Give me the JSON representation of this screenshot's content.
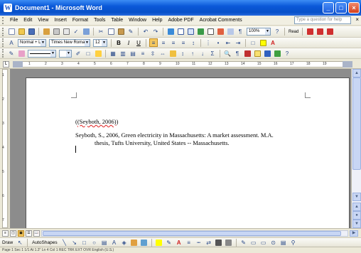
{
  "window": {
    "title": "Document1 - Microsoft Word",
    "app_icon_glyph": "W"
  },
  "menubar": {
    "items": [
      "File",
      "Edit",
      "View",
      "Insert",
      "Format",
      "Tools",
      "Table",
      "Window",
      "Help",
      "Adobe PDF",
      "Acrobat Comments"
    ],
    "help_placeholder": "Type a question for help"
  },
  "formatting": {
    "style": "Normal + Left:",
    "font": "Times New Roman",
    "size": "12",
    "bold": "B",
    "italic": "I",
    "underline": "U"
  },
  "standard": {
    "zoom": "100%",
    "read_label": "Read"
  },
  "ruler": {
    "ticks": [
      "1",
      "2",
      "3",
      "4",
      "5",
      "6",
      "7",
      "8",
      "9",
      "10",
      "11",
      "12",
      "13",
      "14",
      "15",
      "16",
      "17",
      "18",
      "19"
    ]
  },
  "document": {
    "citation": "(Seyboth, 2006)",
    "reference_line1": "Seyboth, S., 2006, Green electricity in Massachusetts: A market assessment. M.A.",
    "reference_line2": "thesis, Tufts University, United States -- Massachusetts."
  },
  "drawbar": {
    "draw_label": "Draw",
    "autoshapes_label": "AutoShapes"
  },
  "status": {
    "text": "Page 1   Sec 1   1/1   At 1.3\"   Ln 4   Col 1   REC  TRK  EXT  OVR   English (U.S.)"
  },
  "colors": {
    "title_blue": "#0a58d8",
    "squiggle_red": "#e02020",
    "highlight_yellow": "#ffff00"
  }
}
